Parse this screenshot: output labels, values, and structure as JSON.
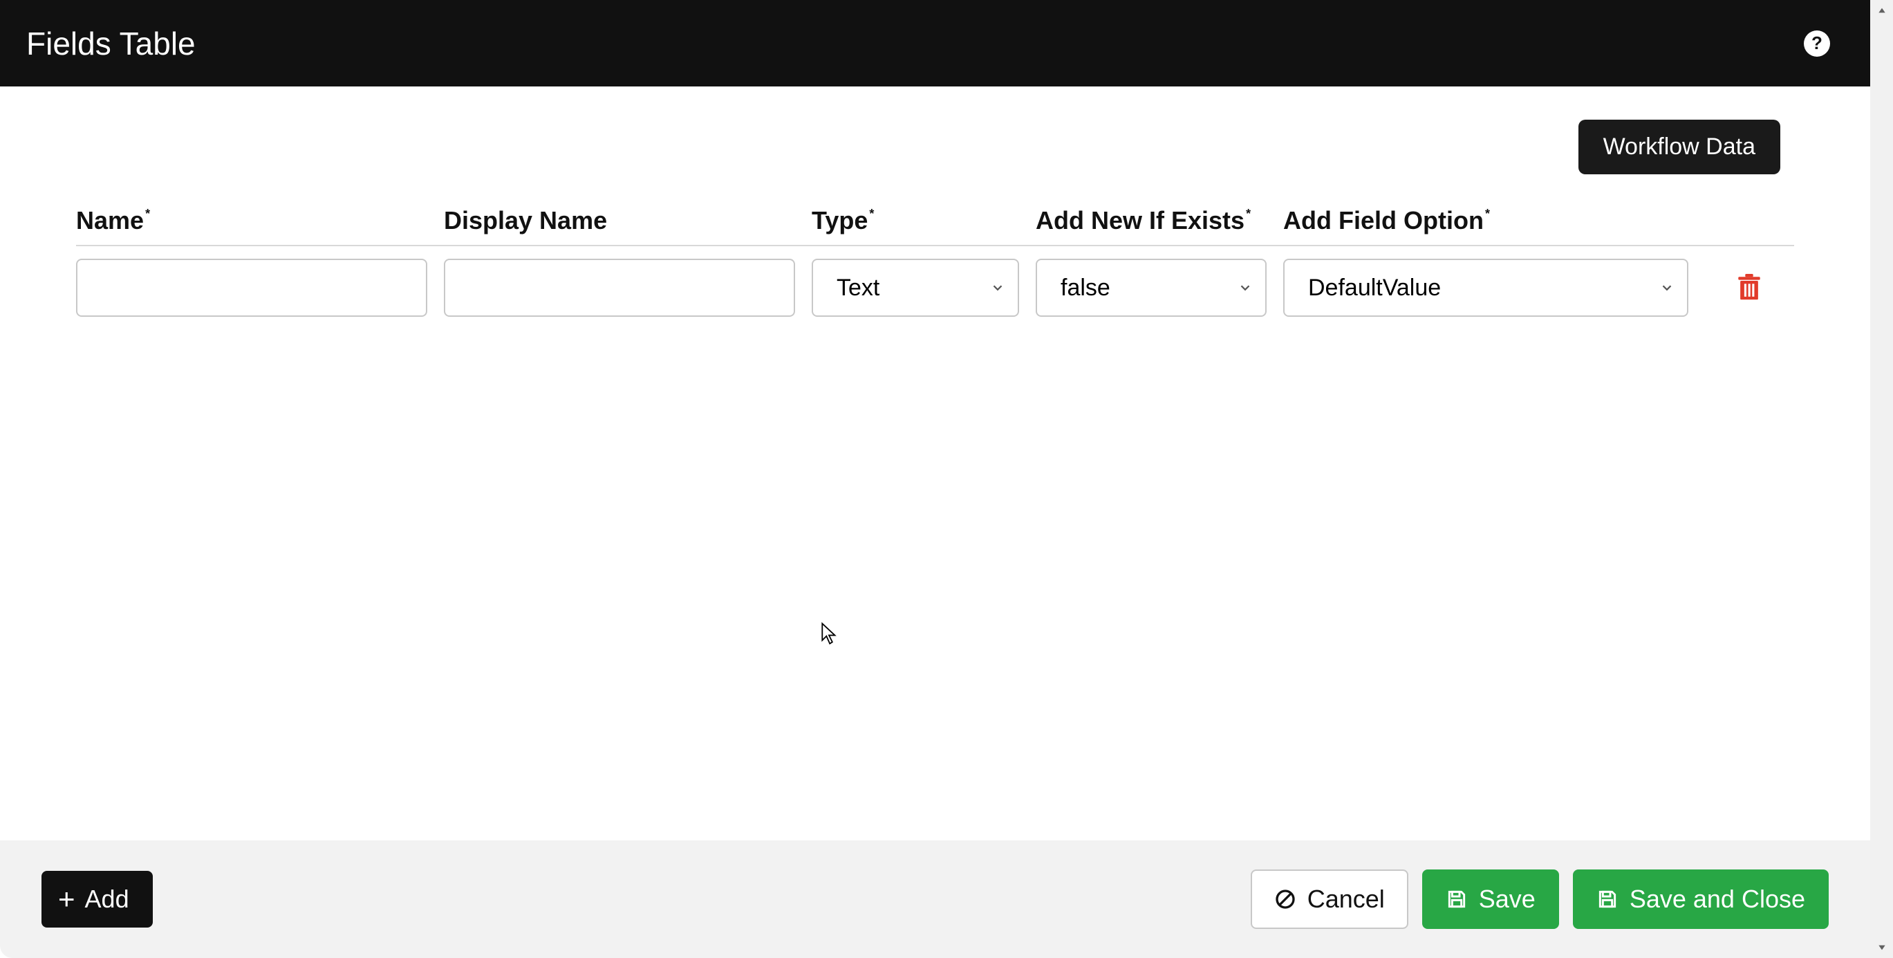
{
  "header": {
    "title": "Fields Table",
    "help_label": "?"
  },
  "toolbar": {
    "workflow_data_label": "Workflow Data"
  },
  "columns": {
    "name": "Name",
    "display_name": "Display Name",
    "type": "Type",
    "add_new_if_exists": "Add New If Exists",
    "add_field_option": "Add Field Option"
  },
  "rows": [
    {
      "name": "",
      "display_name": "",
      "type": "Text",
      "add_new_if_exists": "false",
      "add_field_option": "DefaultValue"
    }
  ],
  "footer": {
    "add_label": "Add",
    "cancel_label": "Cancel",
    "save_label": "Save",
    "save_close_label": "Save and Close"
  }
}
